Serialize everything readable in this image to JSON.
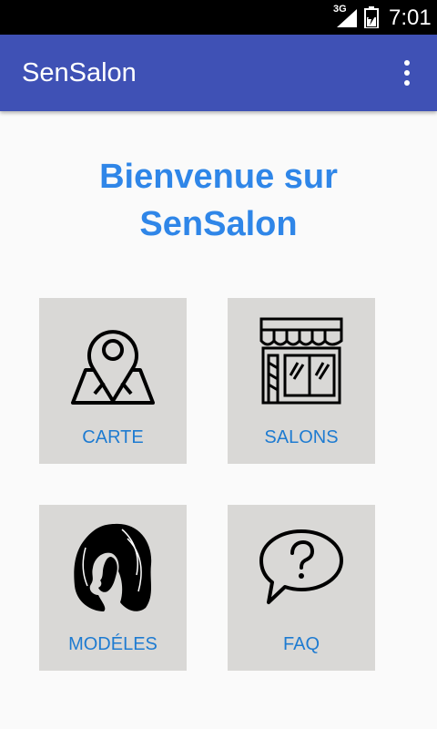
{
  "status_bar": {
    "network": "3G",
    "time": "7:01"
  },
  "app_bar": {
    "title": "SenSalon",
    "menu_icon": "more-vert-icon"
  },
  "welcome": {
    "line1": "Bienvenue sur",
    "line2": "SenSalon"
  },
  "tiles": [
    {
      "label": "CARTE",
      "icon": "map-pin-icon"
    },
    {
      "label": "SALONS",
      "icon": "storefront-icon"
    },
    {
      "label": "MODÉLES",
      "icon": "woman-hair-icon"
    },
    {
      "label": "FAQ",
      "icon": "question-bubble-icon"
    }
  ],
  "colors": {
    "app_bar": "#3f51b5",
    "title_text": "#2f86e8",
    "tile_bg": "#d9d8d6",
    "tile_label": "#1e7bd1"
  }
}
